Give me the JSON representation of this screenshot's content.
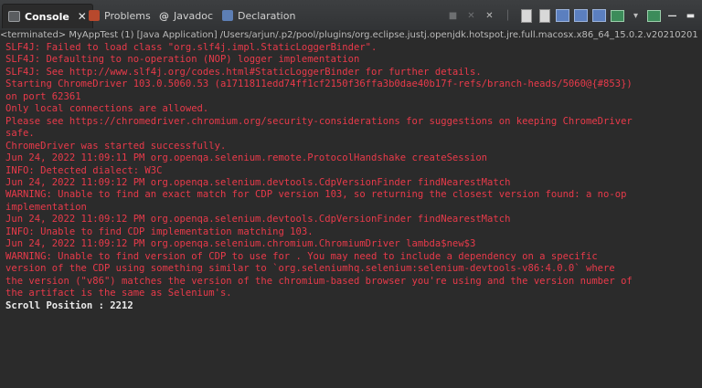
{
  "tabs": [
    {
      "label": "Console",
      "active": true,
      "icon": "console-icon"
    },
    {
      "label": "Problems",
      "active": false,
      "icon": "problems-icon"
    },
    {
      "label": "Javadoc",
      "active": false,
      "icon": "javadoc-icon",
      "glyph": "@"
    },
    {
      "label": "Declaration",
      "active": false,
      "icon": "declaration-icon"
    }
  ],
  "toolbar": {
    "close_glyph": "✕",
    "icons": [
      "terminate-icon",
      "remove-launch-icon",
      "remove-all-terminated-icon",
      "scroll-lock-icon",
      "word-wrap-icon",
      "show-on-stdout-icon",
      "show-on-stderr-icon",
      "pin-console-icon",
      "display-console-icon",
      "open-console-icon",
      "minimize-icon",
      "maximize-icon"
    ]
  },
  "status_line": "<terminated> MyAppTest (1) [Java Application] /Users/arjun/.p2/pool/plugins/org.eclipse.justj.openjdk.hotspot.jre.full.macosx.x86_64_15.0.2.v20210201",
  "console": {
    "lines": [
      {
        "text": "SLF4J: Failed to load class \"org.slf4j.impl.StaticLoggerBinder\".",
        "stream": "err"
      },
      {
        "text": "SLF4J: Defaulting to no-operation (NOP) logger implementation",
        "stream": "err"
      },
      {
        "text": "SLF4J: See http://www.slf4j.org/codes.html#StaticLoggerBinder for further details.",
        "stream": "err"
      },
      {
        "text": "Starting ChromeDriver 103.0.5060.53 (a1711811edd74ff1cf2150f36ffa3b0dae40b17f-refs/branch-heads/5060@{#853})",
        "stream": "err"
      },
      {
        "text": "on port 62361",
        "stream": "err"
      },
      {
        "text": "Only local connections are allowed.",
        "stream": "err"
      },
      {
        "text": "Please see https://chromedriver.chromium.org/security-considerations for suggestions on keeping ChromeDriver",
        "stream": "err"
      },
      {
        "text": "safe.",
        "stream": "err"
      },
      {
        "text": "ChromeDriver was started successfully.",
        "stream": "err"
      },
      {
        "text": "Jun 24, 2022 11:09:11 PM org.openqa.selenium.remote.ProtocolHandshake createSession",
        "stream": "err"
      },
      {
        "text": "INFO: Detected dialect: W3C",
        "stream": "err"
      },
      {
        "text": "Jun 24, 2022 11:09:12 PM org.openqa.selenium.devtools.CdpVersionFinder findNearestMatch",
        "stream": "err"
      },
      {
        "text": "WARNING: Unable to find an exact match for CDP version 103, so returning the closest version found: a no-op",
        "stream": "err"
      },
      {
        "text": "implementation",
        "stream": "err"
      },
      {
        "text": "Jun 24, 2022 11:09:12 PM org.openqa.selenium.devtools.CdpVersionFinder findNearestMatch",
        "stream": "err"
      },
      {
        "text": "INFO: Unable to find CDP implementation matching 103.",
        "stream": "err"
      },
      {
        "text": "Jun 24, 2022 11:09:12 PM org.openqa.selenium.chromium.ChromiumDriver lambda$new$3",
        "stream": "err"
      },
      {
        "text": "WARNING: Unable to find version of CDP to use for . You may need to include a dependency on a specific",
        "stream": "err"
      },
      {
        "text": "version of the CDP using something similar to `org.seleniumhq.selenium:selenium-devtools-v86:4.0.0` where",
        "stream": "err"
      },
      {
        "text": "the version (\"v86\") matches the version of the chromium-based browser you're using and the version number of",
        "stream": "err"
      },
      {
        "text": "the artifact is the same as Selenium's.",
        "stream": "err"
      },
      {
        "text": "Scroll Position : 2212",
        "stream": "out"
      }
    ]
  },
  "colors": {
    "background": "#2b2b2b",
    "stderr": "#e83a4a",
    "stdout": "#ececec"
  }
}
